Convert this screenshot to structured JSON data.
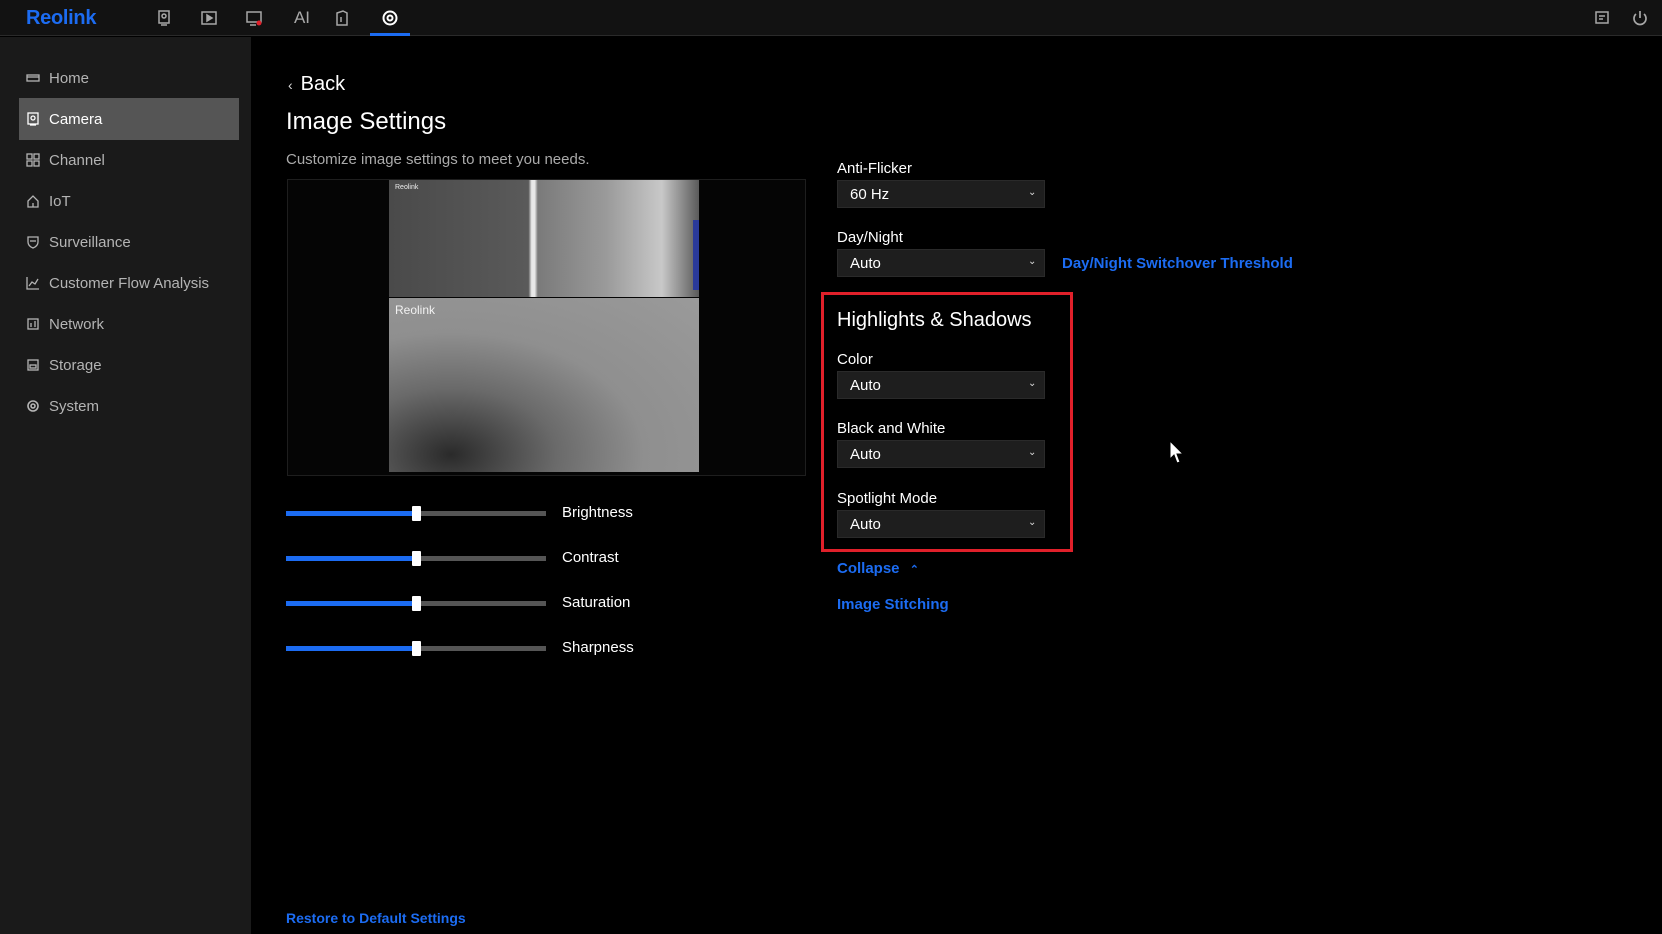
{
  "app": {
    "logo": "Reolink"
  },
  "topbar": {
    "icons": [
      {
        "name": "live-view-icon"
      },
      {
        "name": "playback-icon"
      },
      {
        "name": "alarm-icon"
      },
      {
        "name": "ai-label",
        "label": "AI"
      },
      {
        "name": "file-icon"
      },
      {
        "name": "settings-icon"
      }
    ],
    "right_icons": [
      "message-icon",
      "power-icon"
    ]
  },
  "sidebar": {
    "items": [
      {
        "label": "Home",
        "icon": "home-icon"
      },
      {
        "label": "Camera",
        "icon": "camera-icon",
        "active": true
      },
      {
        "label": "Channel",
        "icon": "channel-icon"
      },
      {
        "label": "IoT",
        "icon": "iot-icon"
      },
      {
        "label": "Surveillance",
        "icon": "shield-icon"
      },
      {
        "label": "Customer Flow Analysis",
        "icon": "chart-icon"
      },
      {
        "label": "Network",
        "icon": "network-icon"
      },
      {
        "label": "Storage",
        "icon": "storage-icon"
      },
      {
        "label": "System",
        "icon": "gear-icon"
      }
    ]
  },
  "main": {
    "back_label": "Back",
    "title": "Image Settings",
    "description": "Customize image settings to meet you needs.",
    "preview": {
      "top_watermark": "Reolink",
      "bottom_watermark": "Reolink"
    },
    "sliders": [
      {
        "label": "Brightness",
        "value": 0.5
      },
      {
        "label": "Contrast",
        "value": 0.5
      },
      {
        "label": "Saturation",
        "value": 0.5
      },
      {
        "label": "Sharpness",
        "value": 0.5
      }
    ],
    "restore_label": "Restore to Default Settings"
  },
  "settings": {
    "anti_flicker": {
      "label": "Anti-Flicker",
      "value": "60 Hz"
    },
    "day_night": {
      "label": "Day/Night",
      "value": "Auto",
      "threshold_link": "Day/Night Switchover Threshold"
    },
    "highlights": {
      "title": "Highlights & Shadows",
      "color": {
        "label": "Color",
        "value": "Auto"
      },
      "bw": {
        "label": "Black and White",
        "value": "Auto"
      },
      "spotlight": {
        "label": "Spotlight Mode",
        "value": "Auto"
      }
    },
    "collapse_label": "Collapse",
    "stitching_label": "Image Stitching"
  },
  "colors": {
    "accent": "#1c6cf2",
    "highlight_box": "#e0202a"
  }
}
